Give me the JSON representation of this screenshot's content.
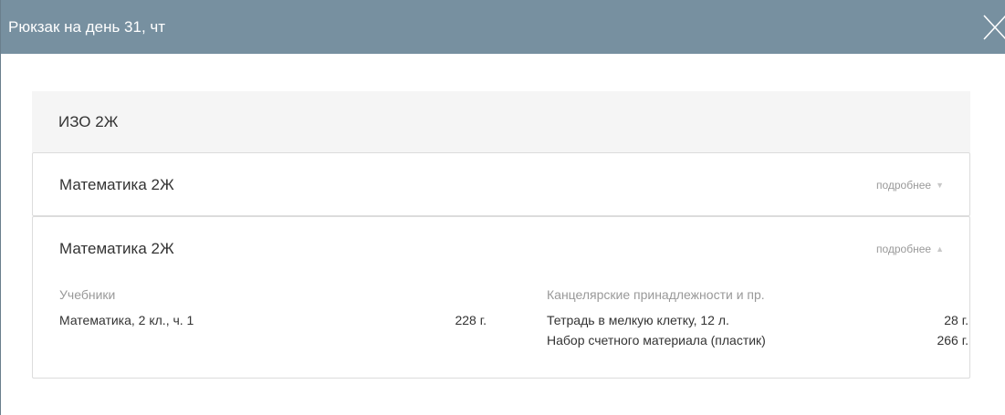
{
  "modal": {
    "title": "Рюкзак на день 31, чт",
    "close_icon": "close-icon"
  },
  "empty_subject": {
    "name": "ИЗО 2Ж"
  },
  "subjects": [
    {
      "name": "Математика 2Ж",
      "toggle_label": "подробнее",
      "arrow": "▼",
      "expanded": false
    },
    {
      "name": "Математика 2Ж",
      "toggle_label": "подробнее",
      "arrow": "▲",
      "expanded": true,
      "textbooks": {
        "heading": "Учебники",
        "items": [
          {
            "name": "Математика, 2 кл., ч. 1",
            "weight": "228 г."
          }
        ]
      },
      "supplies": {
        "heading": "Канцелярские принадлежности и пр.",
        "items": [
          {
            "name": "Тетрадь в мелкую клетку, 12 л.",
            "weight": "28 г."
          },
          {
            "name": "Набор счетного материала (пластик)",
            "weight": "266 г."
          }
        ]
      }
    }
  ],
  "colors": {
    "header_bg": "#7790a0",
    "empty_subject_bg": "#f5f5f5",
    "muted_text": "#999999"
  }
}
